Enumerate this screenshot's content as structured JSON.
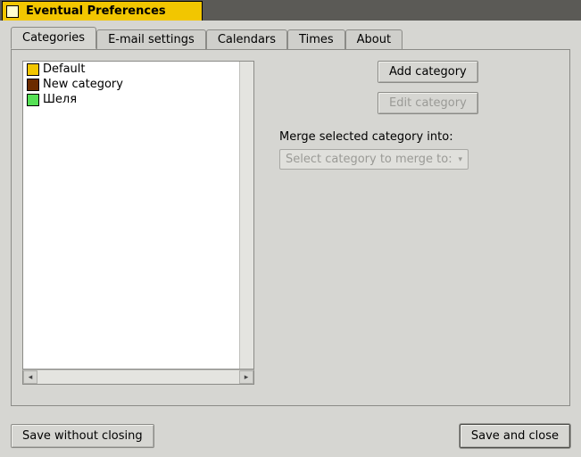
{
  "window": {
    "title": "Eventual Preferences"
  },
  "tabs": [
    {
      "label": "Categories"
    },
    {
      "label": "E-mail settings"
    },
    {
      "label": "Calendars"
    },
    {
      "label": "Times"
    },
    {
      "label": "About"
    }
  ],
  "categories_tab": {
    "items": [
      {
        "color": "#f2c600",
        "label": "Default"
      },
      {
        "color": "#6b2b00",
        "label": "New category"
      },
      {
        "color": "#55e055",
        "label": "Шеля"
      }
    ],
    "add_button": "Add category",
    "edit_button": "Edit category",
    "merge_label": "Merge selected category into:",
    "merge_dropdown": "Select category to merge to:"
  },
  "footer": {
    "save_without_closing": "Save without closing",
    "save_and_close": "Save and close"
  }
}
